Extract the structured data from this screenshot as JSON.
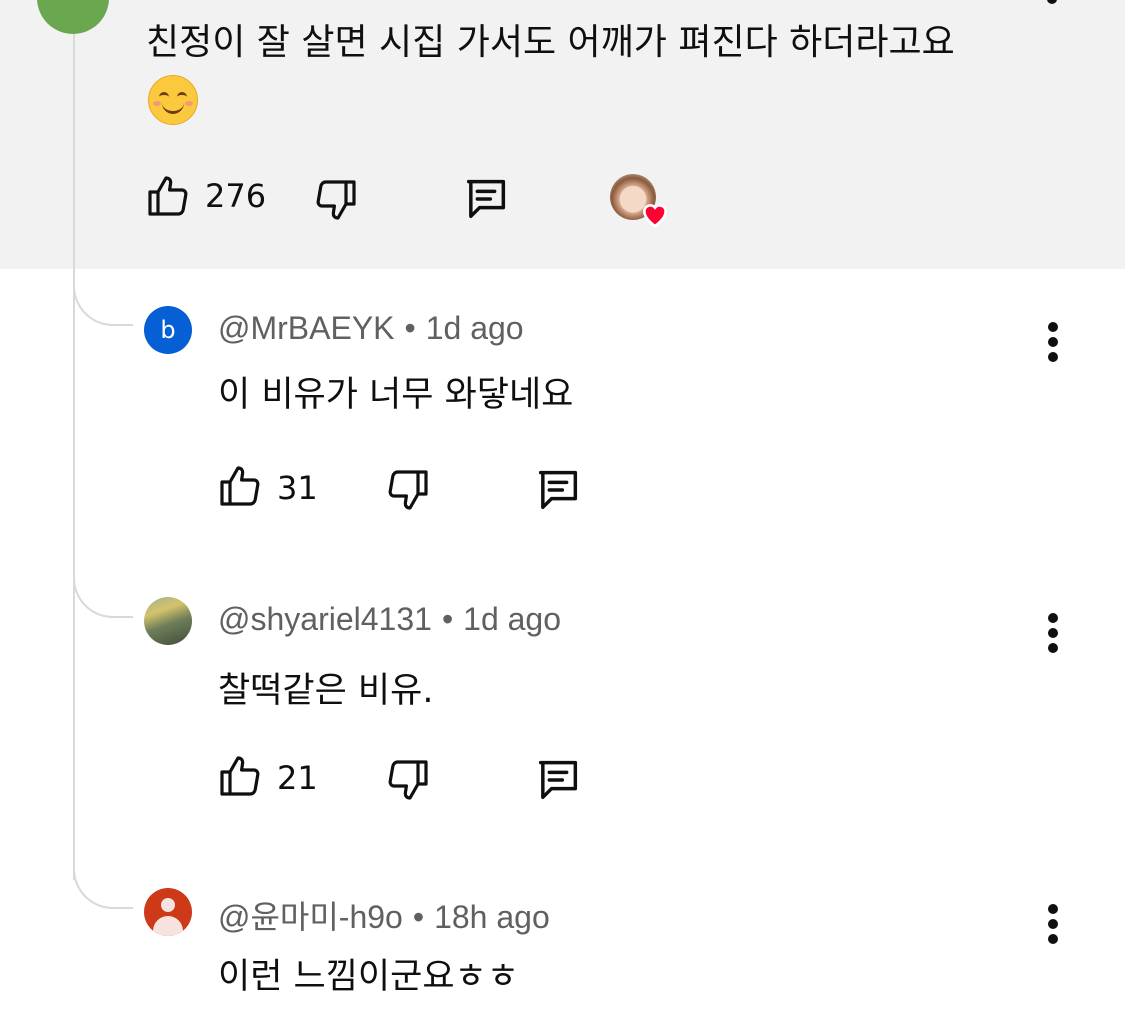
{
  "top_comment": {
    "text": "친정이 잘 살면 시집 가서도 어깨가 펴진다 하더라고요",
    "emoji_name": "smiling-face-emoji",
    "likes": "276"
  },
  "replies": [
    {
      "handle": "@MrBAEYK",
      "time": "1d ago",
      "avatar_letter": "b",
      "text": "이 비유가 너무 와닿네요",
      "likes": "31"
    },
    {
      "handle": "@shyariel4131",
      "time": "1d ago",
      "text": "찰떡같은 비유.",
      "likes": "21"
    },
    {
      "handle": "@윤마미-h9o",
      "time": "18h ago",
      "text": "이런 느낌이군요ㅎㅎ"
    }
  ],
  "separator": "•",
  "colors": {
    "top_bg": "#f2f2f2",
    "meta_text": "#606060",
    "avatar_b": "#065fd4",
    "avatar_person": "#cc3a17",
    "heart": "#ff0033"
  }
}
